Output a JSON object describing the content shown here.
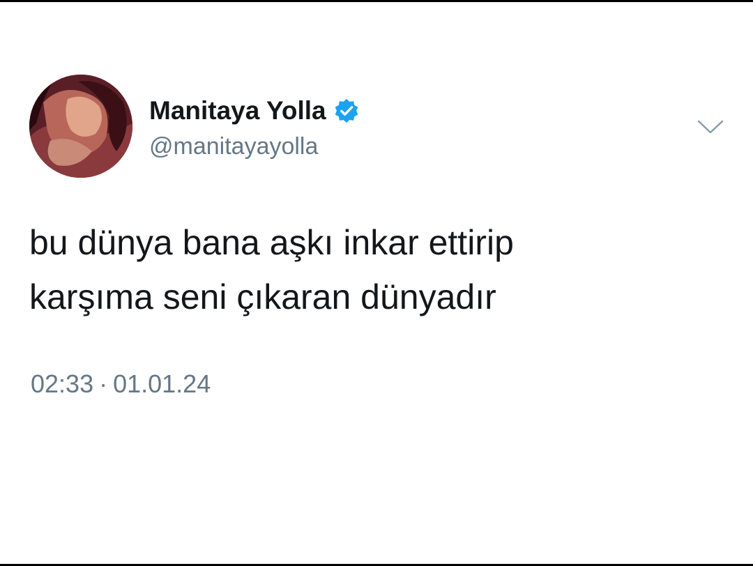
{
  "tweet": {
    "author": {
      "display_name": "Manitaya Yolla",
      "handle": "@manitayayolla",
      "verified": true,
      "avatar_icon": "profile-photo"
    },
    "text_lines": [
      "bu dünya bana aşkı inkar ettirip",
      "karşıma seni çıkaran dünyadır"
    ],
    "time": "02:33",
    "separator": "·",
    "date": "01.01.24",
    "more_icon": "chevron-down-icon"
  },
  "colors": {
    "text_primary": "#14171a",
    "text_secondary": "#657786",
    "verified_blue": "#1da1f2",
    "background": "#ffffff"
  }
}
